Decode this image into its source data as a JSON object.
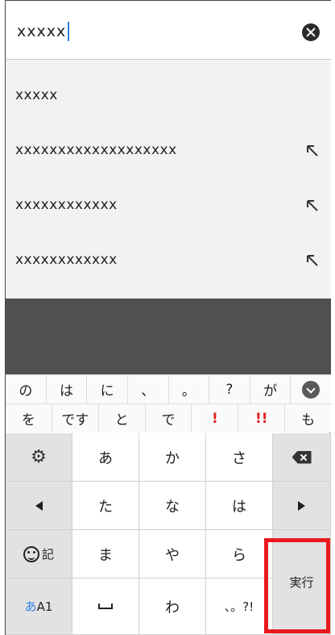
{
  "search": {
    "query": "xxxxx"
  },
  "suggestions": [
    {
      "text": "xxxxx",
      "has_arrow": false
    },
    {
      "text": "xxxxxxxxxxxxxxxxxxx",
      "has_arrow": true
    },
    {
      "text": "xxxxxxxxxxxx",
      "has_arrow": true
    },
    {
      "text": "xxxxxxxxxxxx",
      "has_arrow": true
    }
  ],
  "candidates_row1": [
    "の",
    "は",
    "に",
    "、",
    "。",
    "?",
    "が"
  ],
  "candidates_row2": [
    {
      "text": "を",
      "red": false
    },
    {
      "text": "です",
      "red": false
    },
    {
      "text": "と",
      "red": false
    },
    {
      "text": "で",
      "red": false
    },
    {
      "text": "!",
      "red": true
    },
    {
      "text": "!!",
      "red": true
    },
    {
      "text": "も",
      "red": false
    }
  ],
  "keypad": {
    "row1": [
      "あ",
      "か",
      "さ"
    ],
    "row2": [
      "た",
      "な",
      "は"
    ],
    "row3": [
      "ま",
      "や",
      "ら"
    ],
    "row4": [
      "わ",
      "、。?!"
    ],
    "emoji_label": "記",
    "kana_hira": "あ",
    "kana_alpha": "A1",
    "enter_label": "実行"
  },
  "colors": {
    "accent_blue": "#2f7fe0",
    "highlight_red": "#e8191e",
    "dark_band": "#505050"
  }
}
